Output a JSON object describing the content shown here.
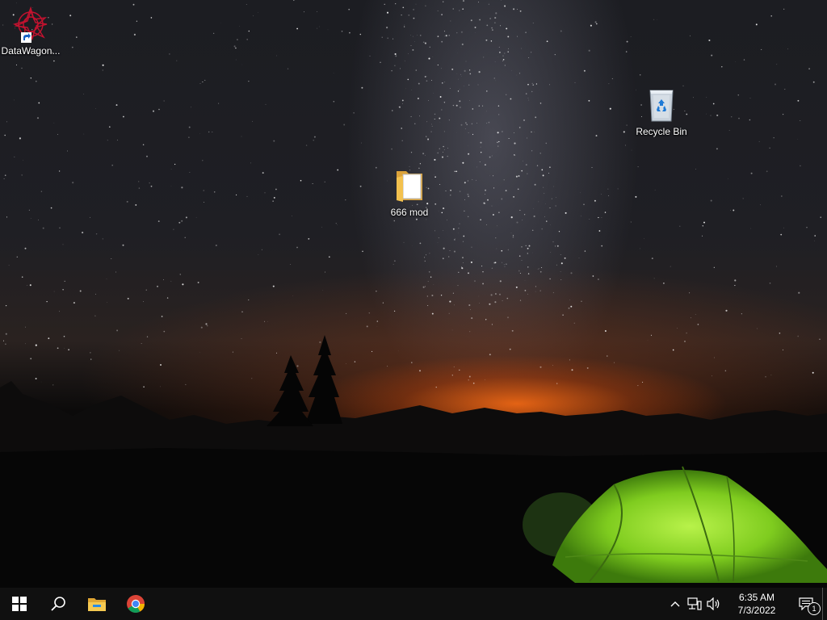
{
  "desktop": {
    "icons": [
      {
        "label": "DataWagon...",
        "kind": "app-shortcut"
      },
      {
        "label": "Recycle Bin",
        "kind": "recycle-bin"
      },
      {
        "label": "666 mod",
        "kind": "folder"
      }
    ]
  },
  "taskbar": {
    "pinned": [
      "start-button",
      "search-button",
      "file-explorer",
      "chrome"
    ],
    "tray": {
      "time": "6:35 AM",
      "date": "7/3/2022",
      "notification_count": "1"
    }
  },
  "colors": {
    "taskbar": "#101010",
    "tent": "#8fd62a",
    "horizon_glow": "#ff6a14",
    "folder": "#f3c14e"
  }
}
